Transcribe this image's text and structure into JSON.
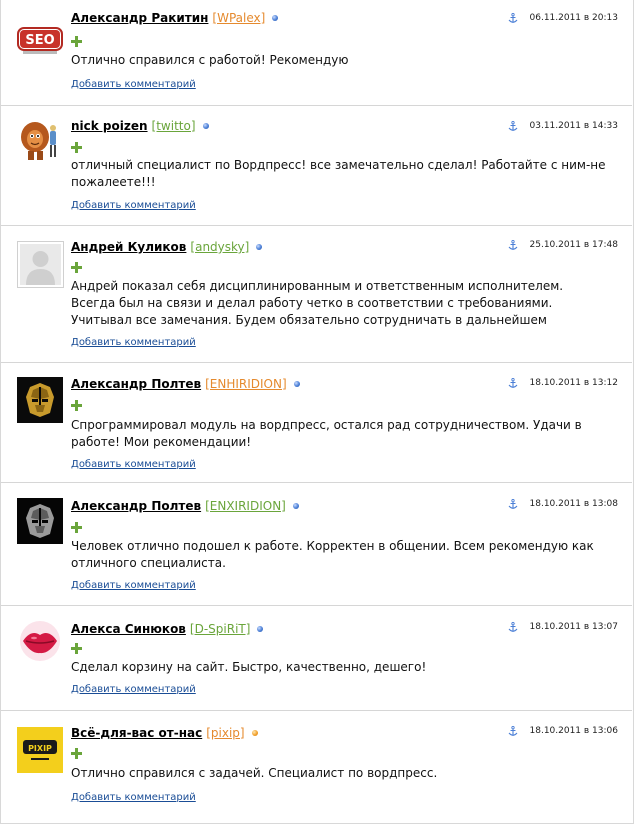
{
  "comments": [
    {
      "author": "Александр Ракитин",
      "login": "[WPalex]",
      "login_color": "#e58a2e",
      "status_color": "blue",
      "date": "06.11.2011 в 20:13",
      "avatar": "seo-logo",
      "avatar_text": "SEO",
      "text": "Отлично справился с работой! Рекомендую",
      "add_comment": "Добавить комментарий"
    },
    {
      "author": "nick poizen",
      "login": "[twitto]",
      "login_color": "#6aa53b",
      "status_color": "blue",
      "date": "03.11.2011 в 14:33",
      "avatar": "lion-character",
      "text": "отличный специалист по Вордпресс! все замечательно сделал! Работайте с ним-не пожалеете!!!",
      "add_comment": "Добавить комментарий"
    },
    {
      "author": "Андрей Куликов",
      "login": "[andysky]",
      "login_color": "#6aa53b",
      "status_color": "blue",
      "date": "25.10.2011 в 17:48",
      "avatar": "default-user",
      "text": "Андрей показал себя дисциплинированным и ответственным исполнителем. Всегда был на связи и делал работу четко в соответствии с требованиями. Учитывал все замечания. Будем обязательно сотрудничать в дальнейшем",
      "add_comment": "Добавить комментарий"
    },
    {
      "author": "Александр Полтев",
      "login": "[ENHIRIDION]",
      "login_color": "#e58a2e",
      "status_color": "blue",
      "date": "18.10.2011 в 13:12",
      "avatar": "autobot-logo",
      "text": "Спрограммировал модуль на вордпресс, остался рад сотрудничеством. Удачи в работе! Мои рекомендации!",
      "add_comment": "Добавить комментарий"
    },
    {
      "author": "Александр Полтев",
      "login": "[ENXIRIDION]",
      "login_color": "#6aa53b",
      "status_color": "blue",
      "date": "18.10.2011 в 13:08",
      "avatar": "autobot-logo-dark",
      "text": "Человек отлично подошел к работе. Корректен в общении. Всем рекомендую как отличного специалиста.",
      "add_comment": "Добавить комментарий"
    },
    {
      "author": "Алекса Синюков",
      "login": "[D-SpiRiT]",
      "login_color": "#6aa53b",
      "status_color": "blue",
      "date": "18.10.2011 в 13:07",
      "avatar": "lips",
      "text": "Сделал корзину на сайт. Быстро, качественно, дешего!",
      "add_comment": "Добавить комментарий"
    },
    {
      "author": "Всё-для-вас от-нас",
      "login": "[pixip]",
      "login_color": "#e58a2e",
      "status_color": "orange",
      "date": "18.10.2011 в 13:06",
      "avatar": "pixip-logo",
      "avatar_text": "PIXIP",
      "text": "Отлично справился с задачей. Специалист по вордпресс.",
      "add_comment": "Добавить комментарий"
    }
  ]
}
